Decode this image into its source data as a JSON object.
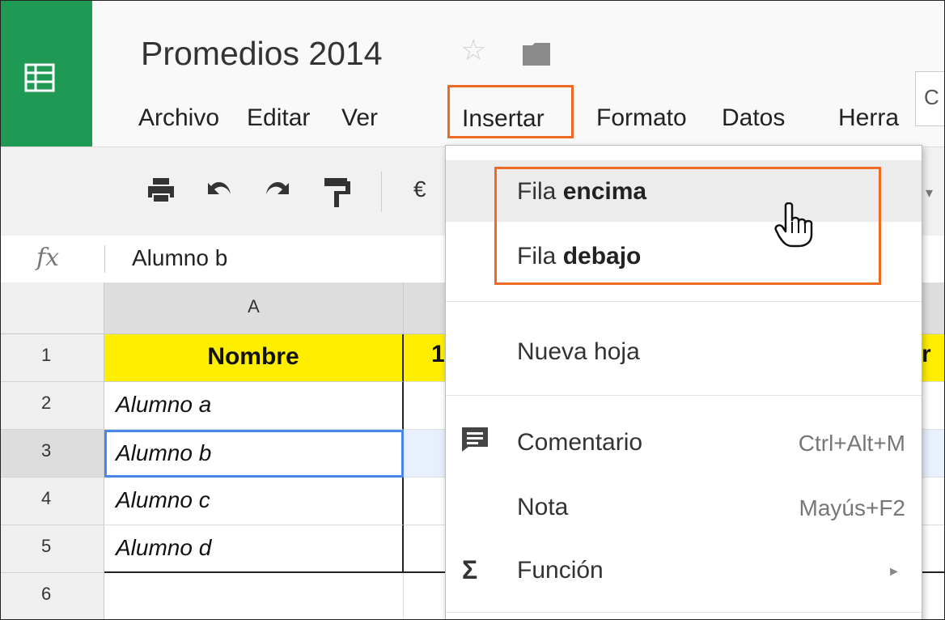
{
  "app": {
    "doc_title": "Promedios 2014",
    "logo_icon": "sheets-icon",
    "accent_color": "#1e9a54",
    "highlight_color": "#ee6a25"
  },
  "menubar": {
    "items": [
      "Archivo",
      "Editar",
      "Ver",
      "Insertar",
      "Formato",
      "Datos",
      "Herra"
    ],
    "partial_right": "C"
  },
  "toolbar": {
    "currency": "€"
  },
  "formula_bar": {
    "fx_label": "fx",
    "value": "Alumno b"
  },
  "grid": {
    "column_a": "A",
    "rows": [
      {
        "num": "1",
        "a": "Nombre",
        "b": "1",
        "c": "tr"
      },
      {
        "num": "2",
        "a": "Alumno a"
      },
      {
        "num": "3",
        "a": "Alumno b"
      },
      {
        "num": "4",
        "a": "Alumno c"
      },
      {
        "num": "5",
        "a": "Alumno d"
      },
      {
        "num": "6",
        "a": ""
      }
    ]
  },
  "insert_menu": {
    "row_above_prefix": "Fila",
    "row_above_bold": "encima",
    "row_below_prefix": "Fila",
    "row_below_bold": "debajo",
    "new_sheet": "Nueva hoja",
    "comment": "Comentario",
    "comment_shortcut": "Ctrl+Alt+M",
    "note": "Nota",
    "note_shortcut": "Mayús+F2",
    "function": "Función",
    "function_symbol": "Σ"
  }
}
